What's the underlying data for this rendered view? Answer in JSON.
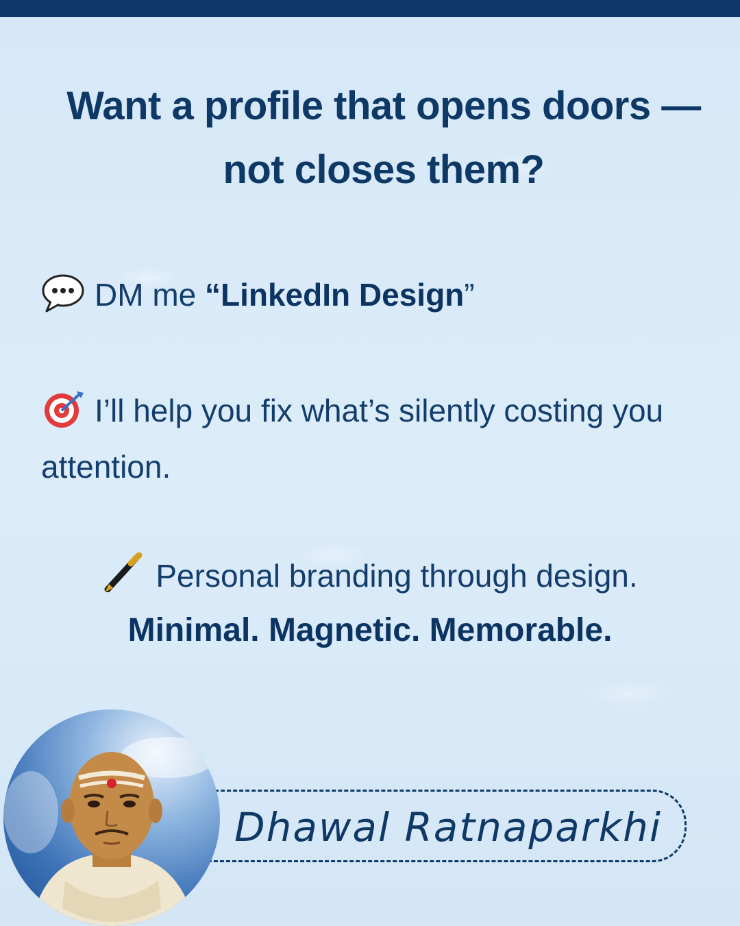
{
  "headline": {
    "line1": "Want a profile that opens doors —",
    "line2": "not closes them?"
  },
  "dm": {
    "icon": "speech-bubble-icon",
    "prefix": "DM me ",
    "open_quote": "“",
    "keyword": "LinkedIn Design",
    "close_quote": "”"
  },
  "help": {
    "icon": "target-icon",
    "text": "I’ll help you fix what’s silently costing you attention."
  },
  "brand": {
    "icon": "fountain-pen-icon",
    "text": "Personal branding through design.",
    "tagline": "Minimal. Magnetic. Memorable."
  },
  "signature": {
    "name": "Dhawal Ratnaparkhi"
  },
  "colors": {
    "background": "#d9eaf8",
    "accent": "#0e3866"
  }
}
